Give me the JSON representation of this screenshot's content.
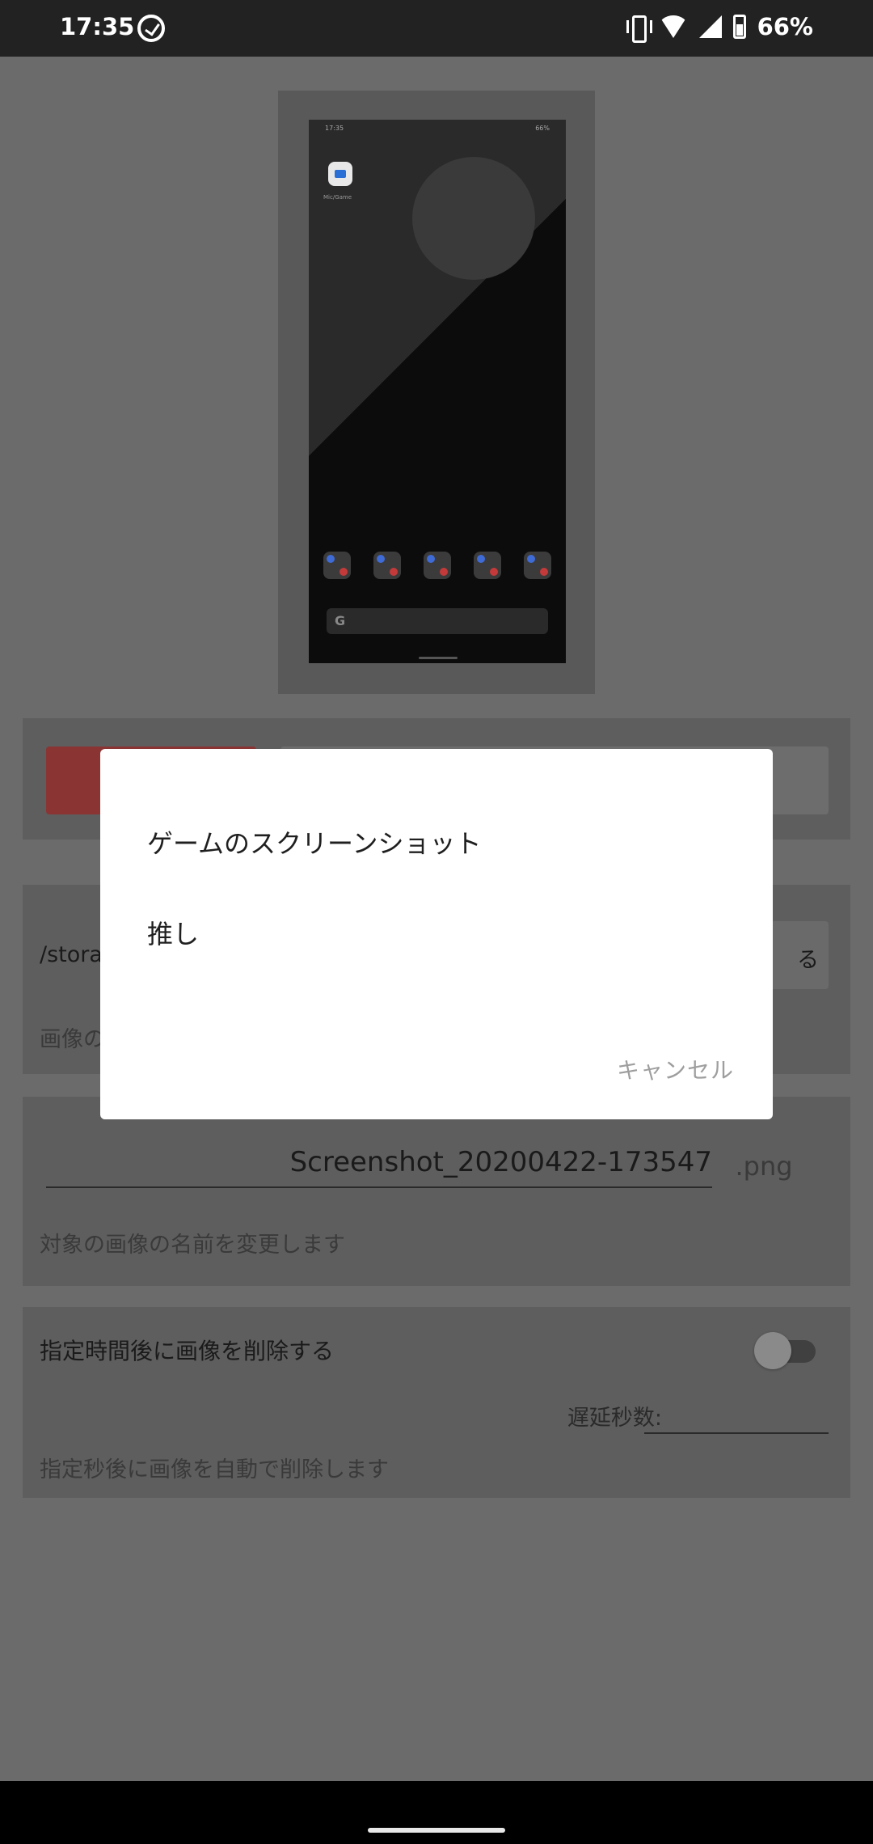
{
  "status_bar": {
    "time": "17:35",
    "battery": "66%",
    "icons": [
      "app-notification-icon",
      "vibrate-icon",
      "wifi-icon",
      "signal-icon",
      "battery-icon"
    ]
  },
  "preview": {
    "status_time": "17:35",
    "status_battery": "66%",
    "app_label": "Mic/Game",
    "search_logo": "G"
  },
  "storage": {
    "path": "/storag",
    "button_label": "る",
    "description": "画像の"
  },
  "filename": {
    "value": "Screenshot_20200422-173547",
    "extension": ".png",
    "description": "対象の画像の名前を変更します"
  },
  "auto_delete": {
    "title": "指定時間後に画像を削除する",
    "delay_label": "遅延秒数:",
    "delay_value": "",
    "enabled": false,
    "description": "指定秒後に画像を自動で削除します"
  },
  "dialog": {
    "options": [
      "ゲームのスクリーンショット",
      "推し"
    ],
    "cancel_label": "キャンセル"
  },
  "colors": {
    "scrim": "#6b6b6b",
    "dialog_bg": "#ffffff",
    "accent_red": "#8a3434"
  }
}
